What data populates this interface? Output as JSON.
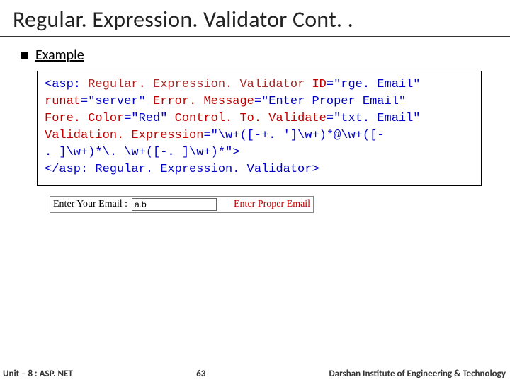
{
  "title": "Regular. Expression. Validator Cont. .",
  "section_label": "Example",
  "code": {
    "l1a": "<asp:",
    "l1b": " Regular. Expression. Validator ",
    "l1c": "ID",
    "l1d": "=\"rge. Email\"",
    "l2a": "runat",
    "l2b": "=\"server\" ",
    "l2c": "Error. Message",
    "l2d": "=\"Enter Proper Email\"",
    "l3a": "Fore. Color",
    "l3b": "=\"Red\" ",
    "l3c": "Control. To. Validate",
    "l3d": "=\"txt. Email\"",
    "l4a": "Validation. Expression",
    "l4b": "=\"\\w+([-+. ']\\w+)*@\\w+([-",
    "l5": ". ]\\w+)*\\. \\w+([-. ]\\w+)*\">",
    "l6": "</asp: Regular. Expression. Validator>"
  },
  "example": {
    "label": "Enter Your Email   :",
    "input_value": "a.b",
    "error": "Enter Proper Email"
  },
  "footer": {
    "left": "Unit – 8 : ASP. NET",
    "mid": "63",
    "right": "Darshan Institute of Engineering & Technology"
  }
}
